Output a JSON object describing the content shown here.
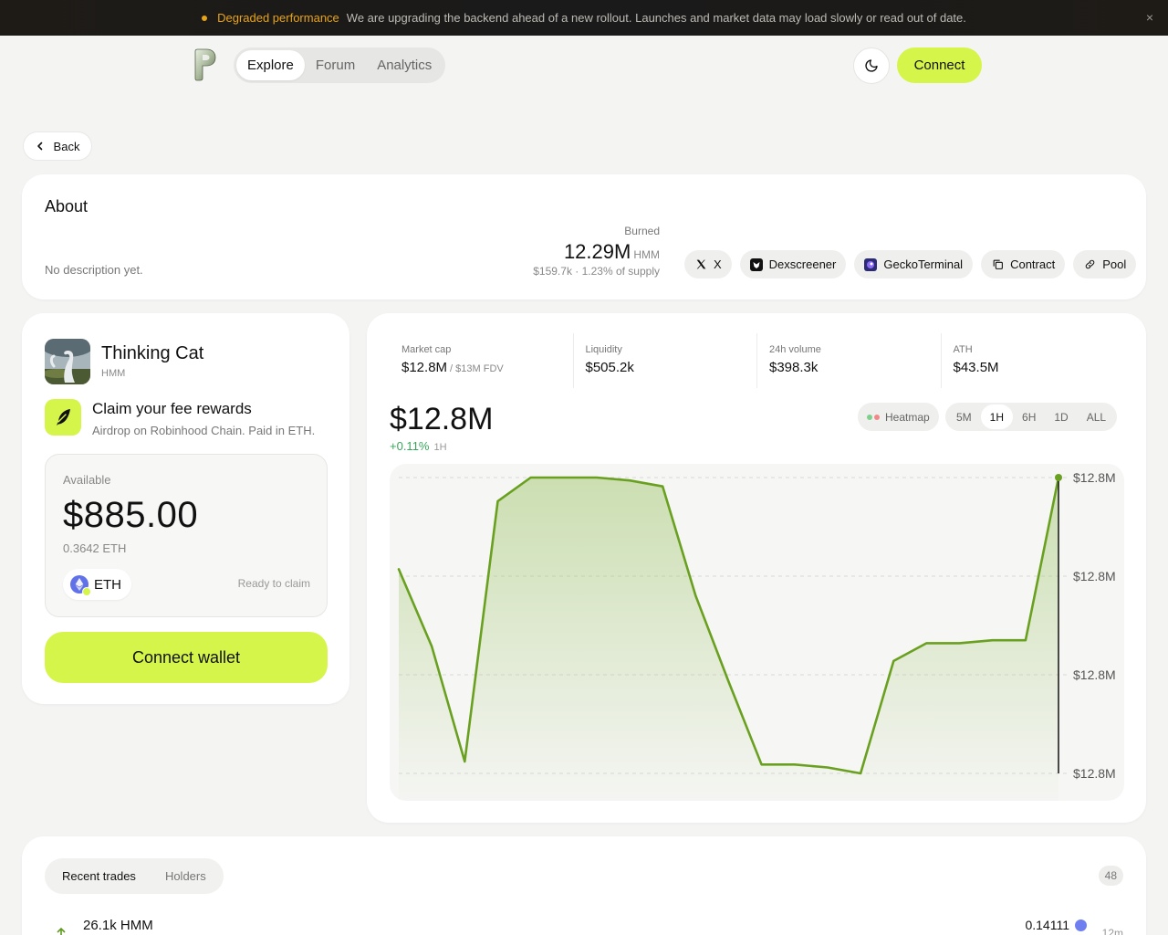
{
  "banner": {
    "title": "Degraded performance",
    "message": "We are upgrading the backend ahead of a new rollout. Launches and market data may load slowly or read out of date.",
    "close_icon": "×"
  },
  "nav": {
    "tabs": [
      {
        "label": "Explore",
        "active": true
      },
      {
        "label": "Forum",
        "active": false
      },
      {
        "label": "Analytics",
        "active": false
      }
    ],
    "connect_label": "Connect"
  },
  "back_label": "Back",
  "about": {
    "heading": "About",
    "description": "No description yet.",
    "burned_label": "Burned",
    "burned_value": "12.29M",
    "burned_unit": "HMM",
    "burned_sub": "$159.7k · 1.23% of supply",
    "links": [
      {
        "label": "X",
        "icon": "x-icon"
      },
      {
        "label": "Dexscreener",
        "icon": "dexscreener-icon"
      },
      {
        "label": "GeckoTerminal",
        "icon": "geckoterminal-icon"
      },
      {
        "label": "Contract",
        "icon": "copy-icon"
      },
      {
        "label": "Pool",
        "icon": "link-icon"
      }
    ]
  },
  "token": {
    "name": "Thinking Cat",
    "symbol": "HMM",
    "claim_title": "Claim your fee rewards",
    "claim_subtitle": "Airdrop on Robinhood Chain. Paid in ETH.",
    "available_label": "Available",
    "available_amount": "$885.00",
    "available_eth": "0.3642 ETH",
    "chip_label": "ETH",
    "status": "Ready to claim",
    "wallet_button": "Connect wallet"
  },
  "stats": [
    {
      "label": "Market cap",
      "value": "$12.8M",
      "sub": "/ $13M FDV"
    },
    {
      "label": "Liquidity",
      "value": "$505.2k",
      "sub": ""
    },
    {
      "label": "24h volume",
      "value": "$398.3k",
      "sub": ""
    },
    {
      "label": "ATH",
      "value": "$43.5M",
      "sub": ""
    }
  ],
  "price": {
    "value": "$12.8M",
    "change": "+0.11%",
    "period": "1H"
  },
  "controls": {
    "heatmap_label": "Heatmap",
    "timeframes": [
      {
        "label": "5M",
        "active": false
      },
      {
        "label": "1H",
        "active": true
      },
      {
        "label": "6H",
        "active": false
      },
      {
        "label": "1D",
        "active": false
      },
      {
        "label": "ALL",
        "active": false
      }
    ]
  },
  "colors": {
    "accent": "#d5f54a",
    "line": "#6aa020",
    "positive": "#3aa55d",
    "warning": "#e8a317"
  },
  "chart_data": {
    "type": "area",
    "y_tick_labels": [
      "$12.8M",
      "$12.8M",
      "$12.8M",
      "$12.8M"
    ],
    "values": [
      0.69,
      0.43,
      0.04,
      0.92,
      1.0,
      1.0,
      1.0,
      0.99,
      0.97,
      0.6,
      0.31,
      0.03,
      0.03,
      0.02,
      0.0,
      0.38,
      0.44,
      0.44,
      0.45,
      0.45,
      1.0
    ],
    "ylim": [
      0,
      1
    ],
    "grid": true
  },
  "trades": {
    "tabs": [
      {
        "label": "Recent trades",
        "active": true
      },
      {
        "label": "Holders",
        "active": false
      }
    ],
    "count": "48",
    "rows": [
      {
        "amount": "26.1k HMM",
        "eth": "0.14111",
        "time": "12m"
      }
    ]
  }
}
